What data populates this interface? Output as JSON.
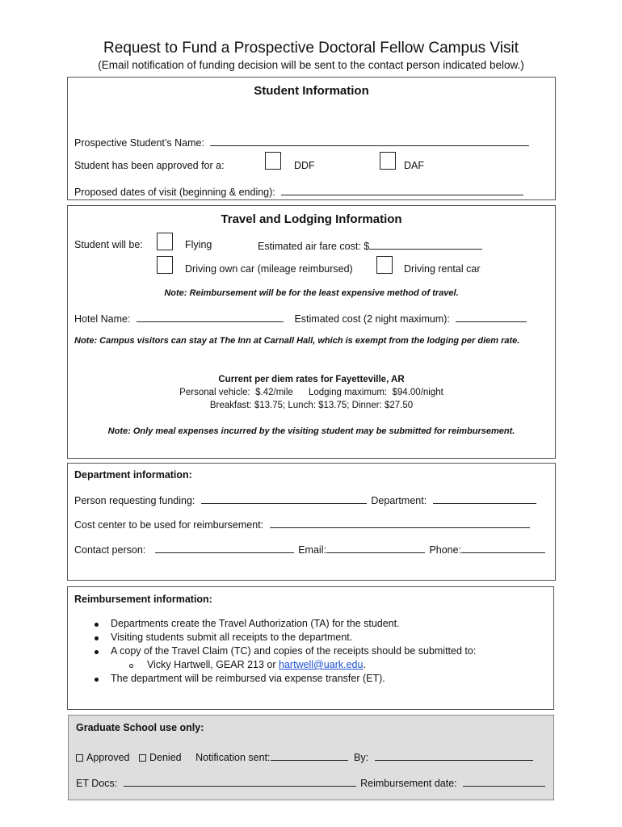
{
  "header": {
    "title": "Request to Fund a Prospective Doctoral Fellow Campus Visit",
    "subtitle": "(Email notification of funding decision will be sent to the contact person indicated below.)"
  },
  "student_info": {
    "heading": "Student Information",
    "name_label": "Prospective Student’s Name:",
    "approved_label": "Student has been approved for a:",
    "options": [
      {
        "label": "DDF",
        "checked": false
      },
      {
        "label": "DAF",
        "checked": false
      }
    ],
    "dates_label": "Proposed dates of visit (beginning & ending):"
  },
  "travel": {
    "heading": "Travel and Lodging Information",
    "student_will_be_label": "Student will be:",
    "flying_label": "Flying",
    "airfare_label": "Estimated air fare cost: $",
    "driving_own_label": "Driving own car (mileage reimbursed)",
    "driving_rental_label": "Driving rental car",
    "note_travel": "Note:  Reimbursement will be for the least expensive method of travel.",
    "hotel_label": "Hotel Name:",
    "est_cost_label": "Estimated cost (2 night maximum):",
    "note_inn": "Note:  Campus visitors can stay at The Inn at Carnall Hall, which is exempt from the lodging per diem rate.",
    "per_diem_heading": "Current per diem rates for Fayetteville, AR",
    "per_diem_line1": "Personal vehicle:  $.42/mile      Lodging maximum:  $94.00/night",
    "per_diem_line2": "Breakfast:  $13.75; Lunch:  $13.75; Dinner:  $27.50",
    "note_meals": "Note:  Only meal expenses incurred by the visiting student may be submitted for reimbursement."
  },
  "department": {
    "heading": "Department information:",
    "person_label": "Person requesting funding:",
    "department_label": "Department:",
    "cost_center_label": "Cost center to be used for reimbursement:",
    "contact_label": "Contact person:",
    "email_label": "Email:",
    "phone_label": "Phone:"
  },
  "reimbursement": {
    "heading": "Reimbursement information:",
    "bullets": [
      "Departments create the Travel Authorization (TA) for the student.",
      "Visiting students submit all receipts to the department.",
      "A copy of the Travel Claim (TC) and copies of the receipts should be submitted to:"
    ],
    "sub_bullet_prefix": "Vicky Hartwell, GEAR 213 or ",
    "sub_bullet_link": "hartwell@uark.edu",
    "sub_bullet_suffix": ".",
    "last_bullet": "The department will be reimbursed via expense transfer (ET)."
  },
  "grad_school": {
    "heading": "Graduate School use only:",
    "approved_label": "Approved",
    "denied_label": "Denied",
    "notification_label": "Notification sent:",
    "by_label": "By:",
    "et_docs_label": "ET Docs:",
    "reimb_date_label": "Reimbursement date:"
  }
}
